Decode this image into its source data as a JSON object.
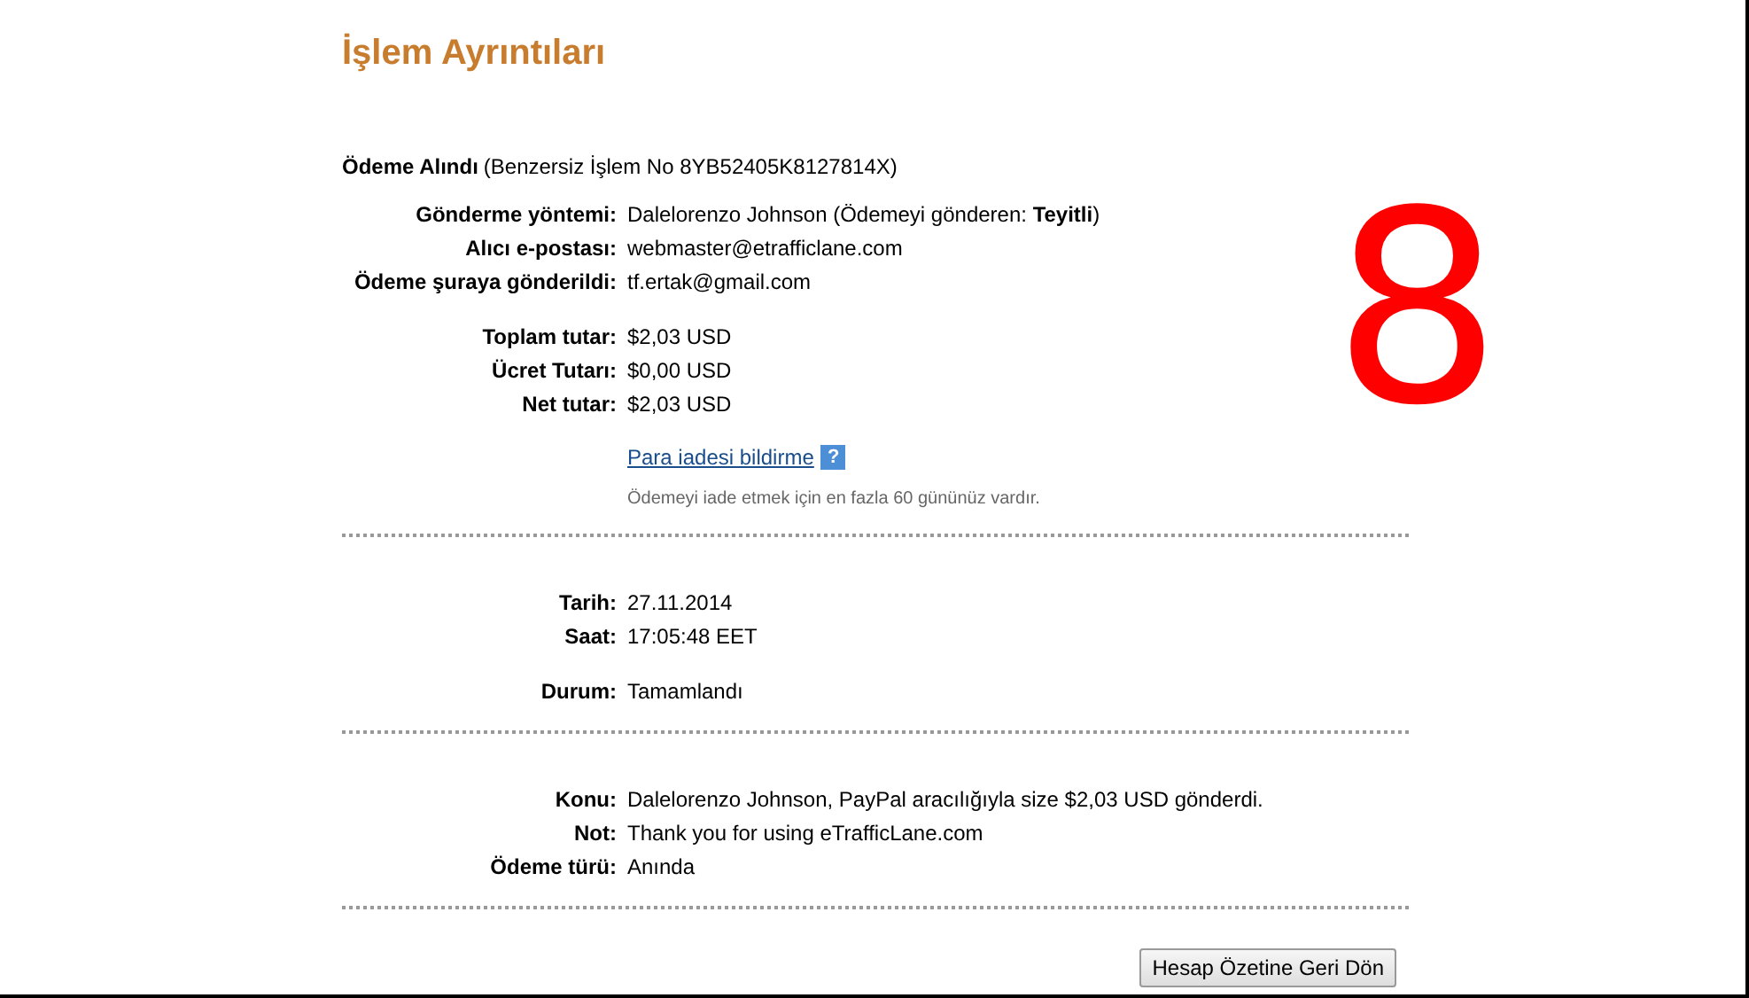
{
  "title": "İşlem Ayrıntıları",
  "receipt": {
    "heading": "Ödeme Alındı",
    "subheading": "(Benzersiz İşlem No 8YB52405K8127814X)"
  },
  "sections": [
    {
      "groups": [
        [
          {
            "label": "Gönderme yöntemi:",
            "value": "Dalelorenzo Johnson (Ödemeyi gönderen: **Teyitli**)"
          },
          {
            "label": "Alıcı e-postası:",
            "value": "webmaster@etrafficlane.com"
          },
          {
            "label": "Ödeme şuraya gönderildi:",
            "value": "tf.ertak@gmail.com"
          }
        ],
        [
          {
            "label": "Toplam tutar:",
            "value": "$2,03 USD"
          },
          {
            "label": "Ücret Tutarı:",
            "value": "$0,00 USD"
          },
          {
            "label": "Net tutar:",
            "value": "$2,03 USD"
          }
        ]
      ],
      "link": "Para iadesi bildirme",
      "help_icon": "?",
      "note": "Ödemeyi iade etmek için en fazla 60 gününüz vardır."
    },
    {
      "groups": [
        [
          {
            "label": "Tarih:",
            "value": "27.11.2014"
          },
          {
            "label": "Saat:",
            "value": "17:05:48 EET"
          }
        ],
        [
          {
            "label": "Durum:",
            "value": "Tamamlandı"
          }
        ]
      ]
    },
    {
      "groups": [
        [
          {
            "label": "Konu:",
            "value": "Dalelorenzo Johnson, PayPal aracılığıyla size $2,03 USD gönderdi."
          },
          {
            "label": "Not:",
            "value": "Thank you for using eTrafficLane.com"
          },
          {
            "label": "Ödeme türü:",
            "value": "Anında"
          }
        ]
      ]
    }
  ],
  "button": "Hesap Özetine Geri Dön",
  "annotation": "8"
}
